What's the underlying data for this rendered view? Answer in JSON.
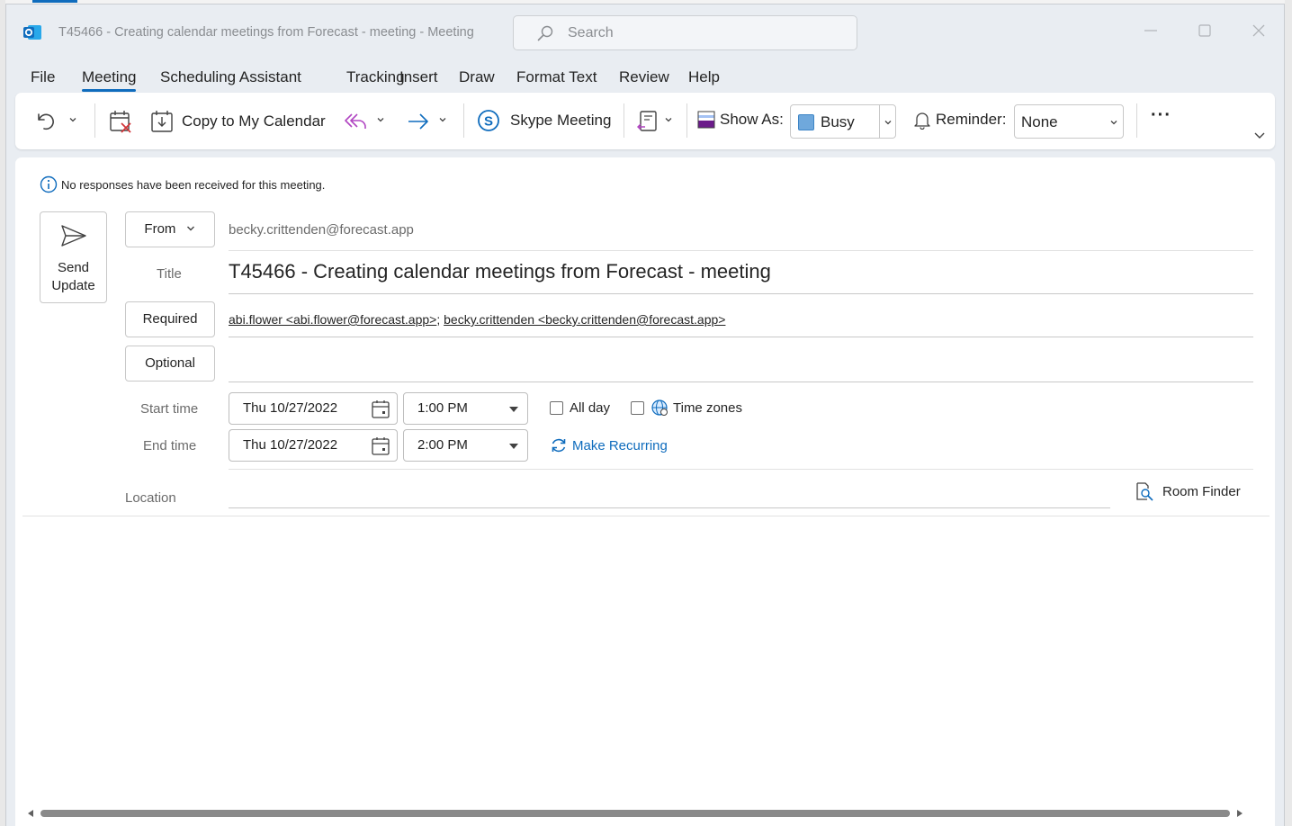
{
  "window": {
    "title": "T45466 - Creating calendar meetings from Forecast - meeting  -  Meeting",
    "search_placeholder": "Search"
  },
  "tabs": [
    {
      "label": "File",
      "active": false
    },
    {
      "label": "Meeting",
      "active": true
    },
    {
      "label": "Scheduling Assistant",
      "active": false
    },
    {
      "label": "Tracking",
      "active": false
    },
    {
      "label": "Insert",
      "active": false
    },
    {
      "label": "Draw",
      "active": false
    },
    {
      "label": "Format Text",
      "active": false
    },
    {
      "label": "Review",
      "active": false
    },
    {
      "label": "Help",
      "active": false
    }
  ],
  "ribbon": {
    "copy_to_calendar": "Copy to My Calendar",
    "skype_meeting": "Skype Meeting",
    "show_as_label": "Show As:",
    "show_as_value": "Busy",
    "reminder_label": "Reminder:",
    "reminder_value": "None",
    "more": "···"
  },
  "form": {
    "info": "No responses have been received for this meeting.",
    "send_update_line1": "Send",
    "send_update_line2": "Update",
    "from_button": "From",
    "from_value": "becky.crittenden@forecast.app",
    "title_label": "Title",
    "title_value": "T45466 - Creating calendar meetings from Forecast - meeting",
    "required_button": "Required",
    "required_1": "abi.flower <abi.flower@forecast.app>",
    "required_sep": ";",
    "required_2": "becky.crittenden <becky.crittenden@forecast.app>",
    "optional_button": "Optional",
    "start_label": "Start time",
    "start_date": "Thu 10/27/2022",
    "start_time": "1:00 PM",
    "end_label": "End time",
    "end_date": "Thu 10/27/2022",
    "end_time": "2:00 PM",
    "all_day": "All day",
    "all_day_checked": false,
    "time_zones": "Time zones",
    "time_zones_checked": false,
    "make_recurring": "Make Recurring",
    "location_label": "Location",
    "location_value": "",
    "room_finder": "Room Finder"
  },
  "colors": {
    "accent": "#0f6cbd",
    "link": "#0f6cbd",
    "outlook_blue": "#0f6cbd",
    "busy_square": "#6fa8dc"
  }
}
